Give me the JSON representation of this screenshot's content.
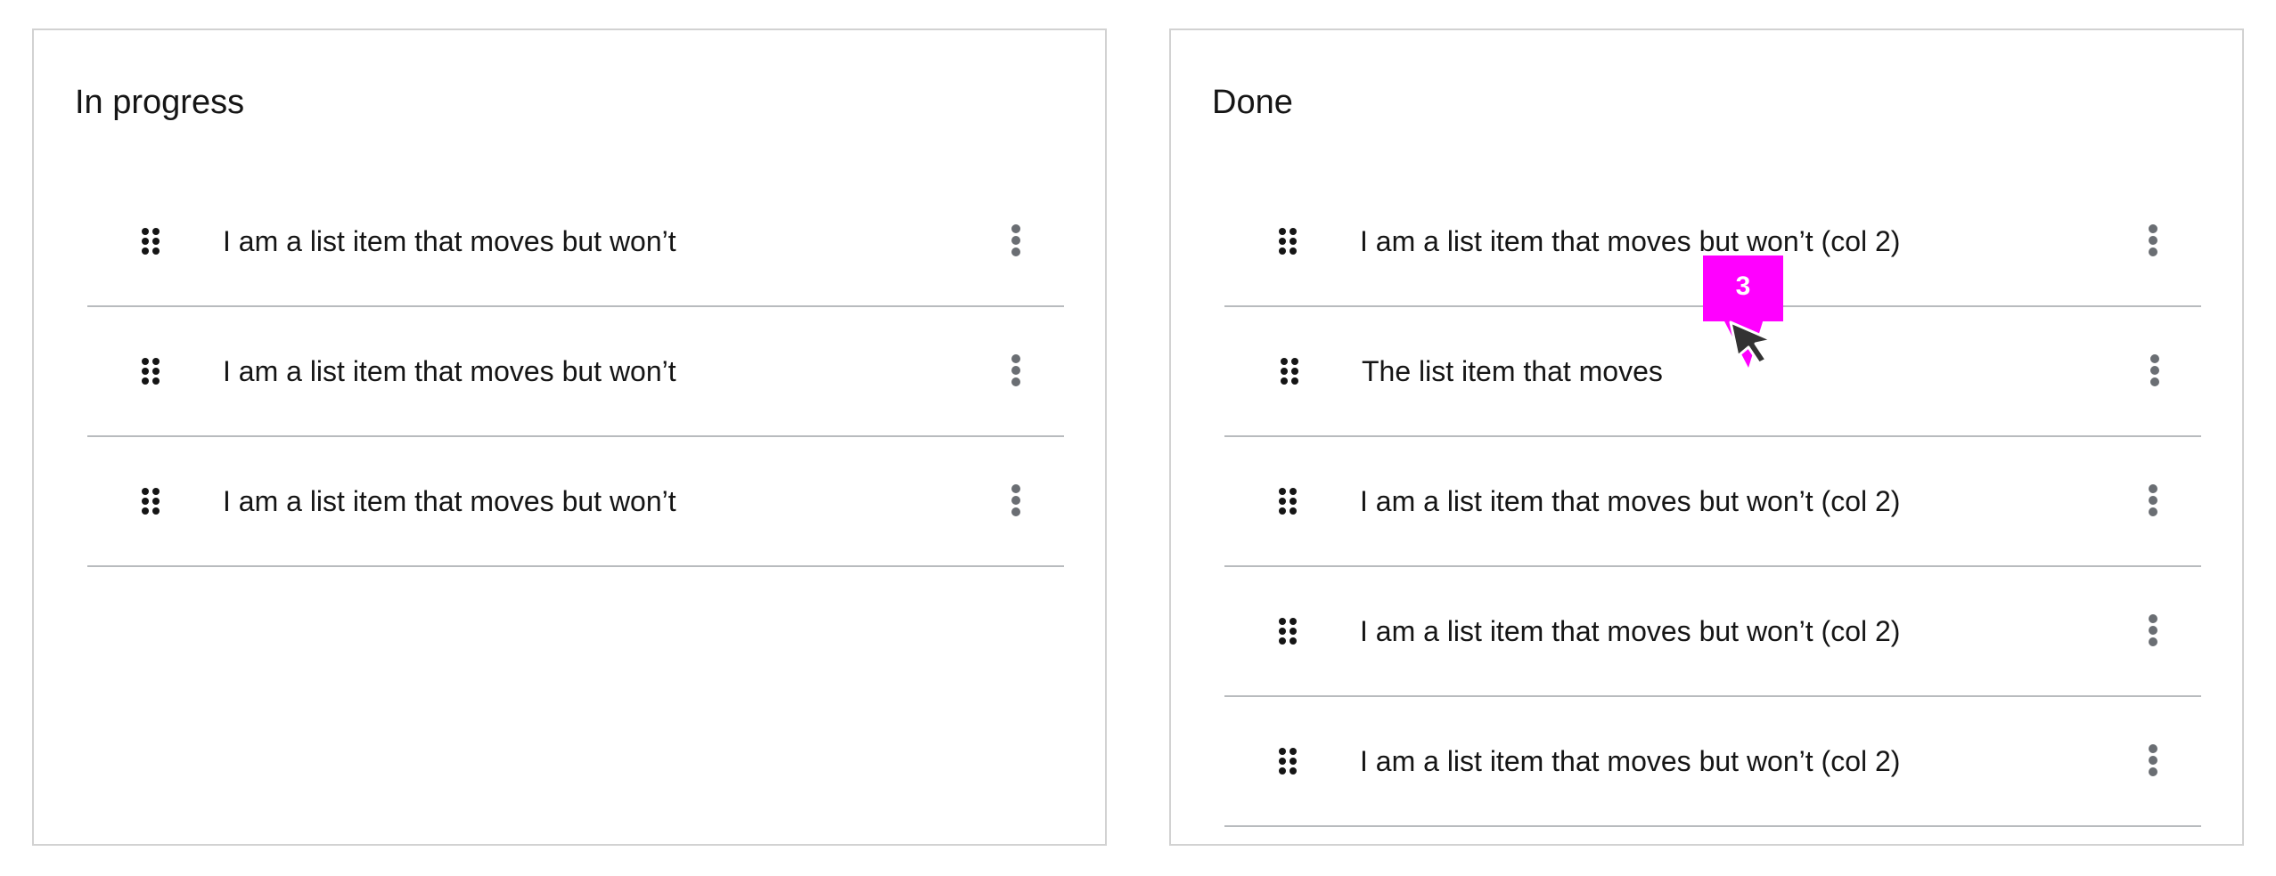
{
  "columns": [
    {
      "title": "In progress",
      "items": [
        {
          "label": "I am a list item that moves but won’t"
        },
        {
          "label": "I am a list item that moves but won’t"
        },
        {
          "label": "I am a list item that moves but won’t"
        }
      ]
    },
    {
      "title": "Done",
      "items": [
        {
          "label": "I am a list item that moves but won’t (col 2)"
        },
        {
          "label": "The list item that moves"
        },
        {
          "label": "I am a list item that moves but won’t (col 2)"
        },
        {
          "label": "I am a list item that moves but won’t (col 2)"
        },
        {
          "label": "I am a list item that moves but won’t (col 2)"
        }
      ]
    }
  ],
  "step_marker": {
    "number": "3",
    "color": "#ff00ff"
  },
  "icons": {
    "drag_handle": "grip-vertical-icon",
    "item_menu": "kebab-menu-icon",
    "cursor": "mouse-pointer-icon"
  },
  "colors": {
    "border": "#d2d2d2",
    "divider": "#b8bbbe",
    "text": "#151515",
    "icon_gray": "#6a6e73"
  }
}
